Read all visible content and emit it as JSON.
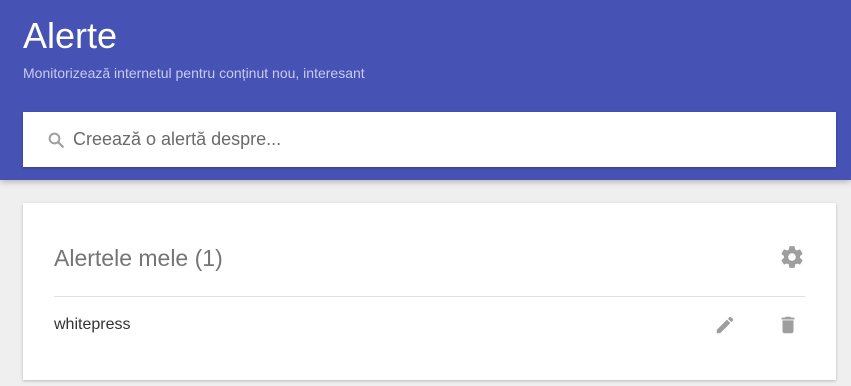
{
  "header": {
    "title": "Alerte",
    "subtitle": "Monitorizează internetul pentru conținut nou, interesant",
    "background_color": "#4653b5"
  },
  "search": {
    "icon": "search-icon",
    "placeholder": "Creează o alertă despre...",
    "value": ""
  },
  "alerts_card": {
    "title": "Alertele mele (1)",
    "settings_icon": "gear-icon",
    "items": [
      {
        "name": "whitepress",
        "edit_icon": "pencil-icon",
        "delete_icon": "trash-icon"
      }
    ]
  }
}
